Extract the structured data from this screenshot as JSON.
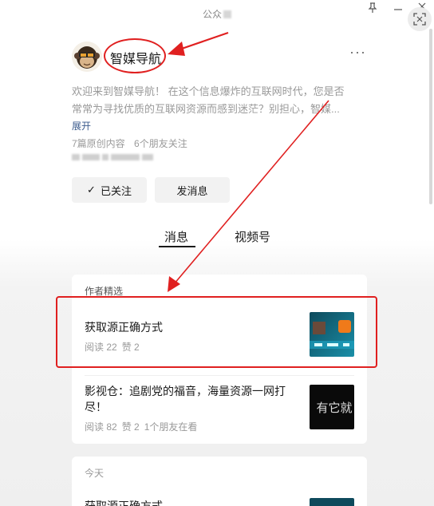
{
  "window": {
    "title": "公众",
    "pin_icon": "pin-icon",
    "minimize_icon": "minimize-icon",
    "close_icon": "close-icon",
    "scan_icon": "scan-icon"
  },
  "profile": {
    "name": "智媒导航",
    "avatar_icon": "monkey-avatar",
    "more_label": "···",
    "description_line1": "欢迎来到智媒导航！ 在这个信息爆炸的互联网时代，您是否",
    "description_line2": "常常为寻找优质的互联网资源而感到迷茫？别担心，智媒...",
    "expand_label": "展开",
    "original_count": "7篇原创内容",
    "friends_follow": "6个朋友关注"
  },
  "actions": {
    "followed_label": "已关注",
    "message_label": "发消息"
  },
  "tabs": [
    {
      "label": "消息",
      "active": true
    },
    {
      "label": "视频号",
      "active": false
    }
  ],
  "featured": {
    "header": "作者精选",
    "articles": [
      {
        "title": "获取源正确方式",
        "reads": "阅读 22",
        "likes": "赞 2"
      },
      {
        "title_line1": "影视仓：追剧党的福音，海量资源一网打",
        "title_line2": "尽！",
        "reads": "阅读 82",
        "likes": "赞 2",
        "friends": "1个朋友在看",
        "thumb_text": "有它就"
      }
    ]
  },
  "today": {
    "header": "今天",
    "articles": [
      {
        "title": "获取源正确方式"
      }
    ]
  },
  "colors": {
    "annotation_red": "#e02020",
    "link_blue": "#3a5a8c"
  }
}
